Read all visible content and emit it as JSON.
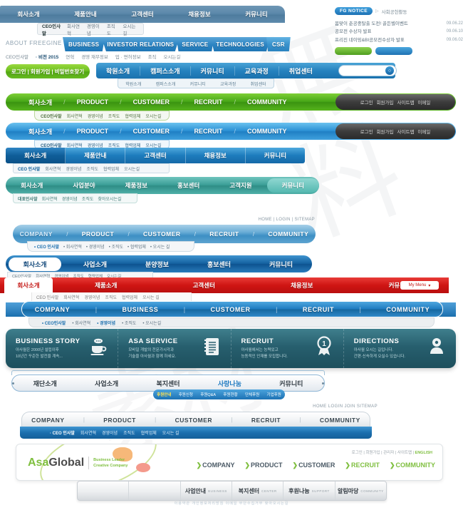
{
  "watermark": {
    "text": "無料",
    "text2": "素材"
  },
  "nav_steel": {
    "items": [
      {
        "label": "회사소개",
        "active": true
      },
      {
        "label": "제품안내",
        "active": false
      },
      {
        "label": "고객센터",
        "active": false
      },
      {
        "label": "채용정보",
        "active": false
      },
      {
        "label": "커뮤니티",
        "active": false
      }
    ],
    "sub": [
      {
        "label": "CEO인사말",
        "active": true
      },
      {
        "label": "회사연혁",
        "active": false
      },
      {
        "label": "경영이념",
        "active": false
      },
      {
        "label": "조직도",
        "active": false
      },
      {
        "label": "오시는 길",
        "active": false
      }
    ]
  },
  "freegine": {
    "brand": "ABOUT FREEGINE",
    "tabs": [
      "BUSINESS",
      "INVESTOR RELATIONS",
      "SERVICE",
      "TECHNOLOGIES",
      "CSR"
    ],
    "sub": [
      {
        "label": "CEO인사말",
        "active": false
      },
      {
        "label": "· 비전 2015",
        "active": true
      },
      {
        "label": "연혁",
        "active": false
      },
      {
        "label": "경영 재무정보",
        "active": false
      },
      {
        "label": "업 · 면허정보",
        "active": false
      },
      {
        "label": "조직",
        "active": false
      },
      {
        "label": "오시는길",
        "active": false
      }
    ]
  },
  "notice": {
    "pill": "FG NOTICE",
    "tab": "사회공헌활동",
    "items": [
      {
        "title": "봄맞이 춘공중탈출 도전! 골든벨이벤트",
        "date": "09.06.22"
      },
      {
        "title": "공모전 수상자 발표",
        "date": "09.06.10"
      },
      {
        "title": "프리진 네이밍&BI공모전수상자 발표",
        "date": "09.06.02"
      }
    ]
  },
  "login_pill": {
    "label": "로그인 | 회원가입 | 비밀번호찾기"
  },
  "academy": {
    "items": [
      "학원소개",
      "캠퍼스소개",
      "커뮤니티",
      "교육과정",
      "취업센터"
    ],
    "sub": [
      "학원소개",
      "캠퍼스소개",
      "커뮤니티",
      "교육과정",
      "취업센터"
    ],
    "search_placeholder": "",
    "search_value": ""
  },
  "bigbar_green": {
    "items": [
      "회사소개",
      "PRODUCT",
      "CUSTOMER",
      "RECRUIT",
      "COMMUNITY"
    ],
    "util": [
      "로그인",
      "회원가입",
      "사이트맵",
      "이메일"
    ],
    "sub": [
      {
        "label": "CEO인사말",
        "active": true
      },
      {
        "label": "회사연혁",
        "active": false
      },
      {
        "label": "경영이념",
        "active": false
      },
      {
        "label": "조직도",
        "active": false
      },
      {
        "label": "협력업체",
        "active": false
      },
      {
        "label": "오시는길",
        "active": false
      }
    ]
  },
  "bigbar_blue": {
    "items": [
      "회사소개",
      "PRODUCT",
      "CUSTOMER",
      "RECRUIT",
      "COMMUNITY"
    ],
    "util": [
      "로그인",
      "회원가입",
      "사이트맵",
      "이메일"
    ],
    "sub": [
      {
        "label": "CEO인사말",
        "active": true
      },
      {
        "label": "회사연혁",
        "active": false
      },
      {
        "label": "경영이념",
        "active": false
      },
      {
        "label": "조직도",
        "active": false
      },
      {
        "label": "협력업체",
        "active": false
      },
      {
        "label": "오시는길",
        "active": false
      }
    ]
  },
  "blockbar": {
    "items": [
      "회사소개",
      "제품안내",
      "고객센터",
      "채용정보",
      "커뮤니티"
    ],
    "sub": [
      {
        "label": "CEO 인사말",
        "active": true
      },
      {
        "label": "회사연혁",
        "active": false
      },
      {
        "label": "경영이념",
        "active": false
      },
      {
        "label": "조직도",
        "active": false
      },
      {
        "label": "협력업체",
        "active": false
      },
      {
        "label": "오시는길",
        "active": false
      }
    ]
  },
  "tealbar": {
    "items": [
      {
        "label": "회사소개",
        "active": false
      },
      {
        "label": "사업분야",
        "active": false
      },
      {
        "label": "제품정보",
        "active": false
      },
      {
        "label": "홍보센터",
        "active": false
      },
      {
        "label": "고객지원",
        "active": false
      },
      {
        "label": "커뮤니티",
        "active": true
      }
    ],
    "sub": [
      {
        "label": "대표인사말",
        "active": true
      },
      {
        "label": "회사연혁",
        "active": false
      },
      {
        "label": "경영이념",
        "active": false
      },
      {
        "label": "조직도",
        "active": false
      },
      {
        "label": "찾아오시는길",
        "active": false
      }
    ]
  },
  "utility_top": "HOME  |  LOGIN  |  SITEMAP",
  "pillbar": {
    "items": [
      {
        "label": "COMPANY",
        "active": true
      },
      {
        "label": "PRODUCT",
        "active": false
      },
      {
        "label": "CUSTOMER",
        "active": false
      },
      {
        "label": "RECRUIT",
        "active": false
      },
      {
        "label": "COMMUNITY",
        "active": false
      }
    ],
    "separator": "/",
    "sub": [
      {
        "label": "• CEO 인사말",
        "active": true
      },
      {
        "label": "• 회사연혁",
        "active": false
      },
      {
        "label": "• 경영이념",
        "active": false
      },
      {
        "label": "• 조직도",
        "active": false
      },
      {
        "label": "• 협력업체",
        "active": false
      },
      {
        "label": "• 오시는 길",
        "active": false
      }
    ]
  },
  "navybar": {
    "items": [
      {
        "label": "회사소개",
        "active": true
      },
      {
        "label": "사업소개",
        "active": false
      },
      {
        "label": "분양정보",
        "active": false
      },
      {
        "label": "홍보센터",
        "active": false
      },
      {
        "label": "커뮤니티",
        "active": false
      }
    ],
    "sub": [
      "CEO인사말",
      "회사연혁",
      "경영이념",
      "조직도",
      "협력업체",
      "오시는길"
    ]
  },
  "redbar": {
    "items": [
      {
        "label": "회사소개",
        "active": true
      },
      {
        "label": "제품소개",
        "active": false
      },
      {
        "label": "고객센터",
        "active": false
      },
      {
        "label": "채용정보",
        "active": false
      },
      {
        "label": "커뮤니티",
        "active": false
      }
    ],
    "mymenu": "My Menu",
    "sub": [
      "CEO 인사말",
      "회사연혁",
      "경영이념",
      "조직도",
      "협력업체",
      "오시는 길"
    ]
  },
  "ribbon": {
    "items": [
      "COMPANY",
      "BUSINESS",
      "CUSTOMER",
      "RECRUIT",
      "COMMUNITY"
    ],
    "separator": "|",
    "sub": [
      {
        "label": "• CEO인사말",
        "active": true
      },
      {
        "label": "• 회사연혁",
        "active": false
      },
      {
        "label": "• 경영이념",
        "active": true
      },
      {
        "label": "• 조직도",
        "active": false
      },
      {
        "label": "• 오시는길",
        "active": false
      }
    ]
  },
  "features": [
    {
      "title": "BUSINESS STORY",
      "line1": "아사월은 2000년 설립이후",
      "line2": "10년간 꾸준한 발전을 계속...",
      "icon": "coffee-cup-icon"
    },
    {
      "title": "ASA SERVICE",
      "line1": "모바일 개발의 전문가시각과",
      "line2": "기술을 아사월과 함께 하세요.",
      "icon": "notebook-icon"
    },
    {
      "title": "RECRUIT",
      "line1": "아사월에서는 능력있고",
      "line2": "능동적인 인재를 모집합니다.",
      "icon": "award-ribbon-icon"
    },
    {
      "title": "DIRECTIONS",
      "line1": "아사월 오시는 길입니다.",
      "line2": "간편·신속하게 오실수 있습니다.",
      "icon": "person-icon"
    }
  ],
  "whitebar": {
    "items": [
      {
        "label": "재단소개",
        "active": false
      },
      {
        "label": "사업소개",
        "active": false
      },
      {
        "label": "복지센터",
        "active": false
      },
      {
        "label": "사랑나눔",
        "active": true
      },
      {
        "label": "커뮤니티",
        "active": false
      }
    ],
    "subpill": [
      {
        "label": "후원안내",
        "active": true
      },
      {
        "label": "후원신청",
        "active": false
      },
      {
        "label": "후원Q&A",
        "active": false
      },
      {
        "label": "후원현황",
        "active": false
      },
      {
        "label": "단체후원",
        "active": false
      },
      {
        "label": "기업후원",
        "active": false
      }
    ]
  },
  "utility_bottom": "HOME   LOGIN   JOIN   SITEMAP",
  "graybar": {
    "items": [
      "COMPANY",
      "PRODUCT",
      "CUSTOMER",
      "RECRUIT",
      "COMMUNITY"
    ],
    "separator": "|",
    "sub": [
      {
        "label": "· CEO 인사말",
        "active": true
      },
      {
        "label": "회사연혁",
        "active": false
      },
      {
        "label": "경영이념",
        "active": false
      },
      {
        "label": "조직도",
        "active": false
      },
      {
        "label": "협력업체",
        "active": false
      },
      {
        "label": "오시는 길",
        "active": false
      }
    ]
  },
  "asa": {
    "logo_a": "Asa",
    "logo_b": "Global",
    "tagline1": "Business Leader",
    "tagline2": "Creative Company",
    "utility": [
      {
        "label": "로그인",
        "accent": false
      },
      {
        "label": "회원가입",
        "accent": false
      },
      {
        "label": "관리자",
        "accent": false
      },
      {
        "label": "사이트맵",
        "accent": false
      },
      {
        "label": "ENGLISH",
        "accent": true
      }
    ],
    "nav": [
      {
        "label": "COMPANY",
        "arrow": "❯"
      },
      {
        "label": "PRODUCT",
        "arrow": "❯"
      },
      {
        "label": "CUSTOMER",
        "arrow": "❯"
      },
      {
        "label": "RECRUIT",
        "arrow": "❯"
      },
      {
        "label": "COMMUNITY",
        "arrow": "❯"
      }
    ]
  },
  "bottom_tabs": [
    {
      "ko": "",
      "en": ""
    },
    {
      "ko": "",
      "en": ""
    },
    {
      "ko": "사업안내",
      "en": "BUSINESS"
    },
    {
      "ko": "복지센터",
      "en": "CENTER"
    },
    {
      "ko": "후원나눔",
      "en": "SUPPORT"
    },
    {
      "ko": "알림마당",
      "en": "COMMUNITY"
    }
  ],
  "bottom_footer": "이용약관 개인정보처리방침   이메일   무단수집거부   찾아오시는길",
  "colors": {
    "steel": "#5c89ab",
    "blue": "#1d7cbd",
    "green": "#4f9e1f",
    "teal": "#3a9d96",
    "navy": "#1461a0",
    "red": "#cf1513",
    "dark_teal": "#275f6e",
    "asa_green": "#7fbf3f"
  }
}
